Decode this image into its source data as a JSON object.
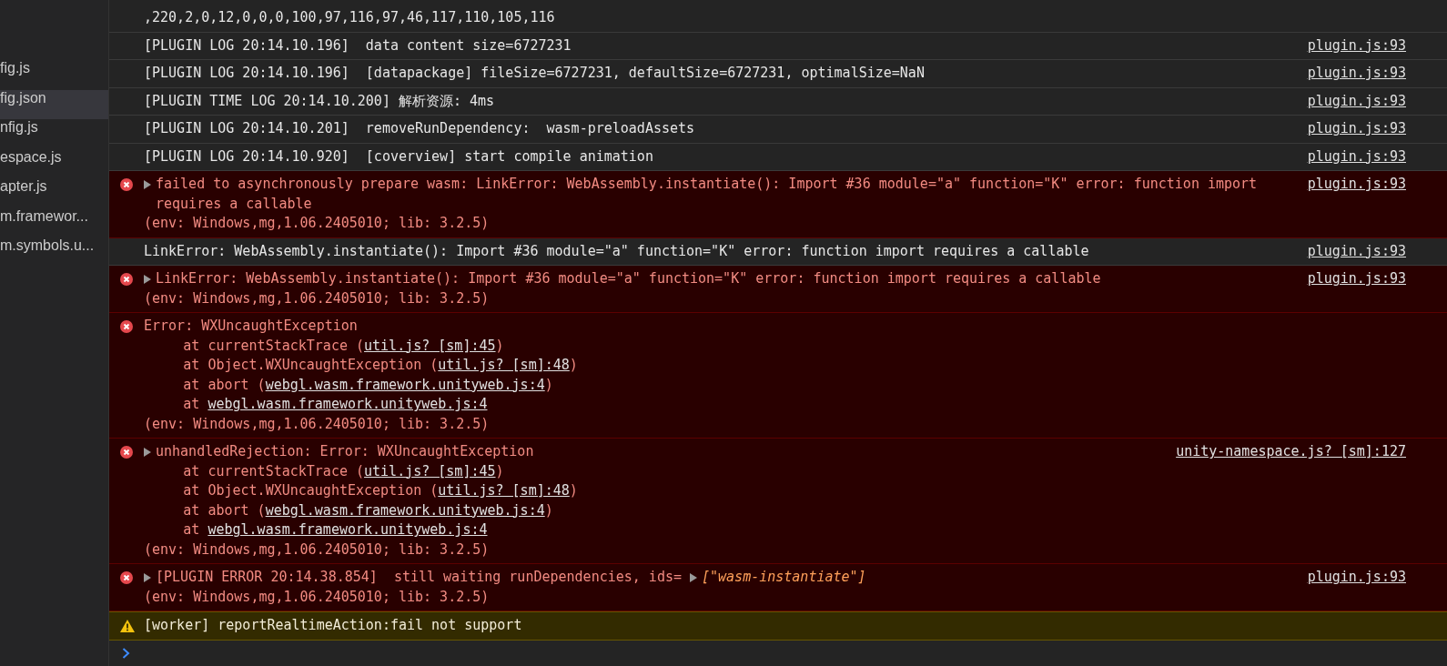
{
  "sidebar": {
    "items": [
      {
        "label": "fig.js",
        "selected": false
      },
      {
        "label": "fig.json",
        "selected": true
      },
      {
        "label": "nfig.js",
        "selected": false
      },
      {
        "label": "espace.js",
        "selected": false
      },
      {
        "label": "apter.js",
        "selected": false
      },
      {
        "label": "m.framewor...",
        "selected": false
      },
      {
        "label": "m.symbols.u...",
        "selected": false
      }
    ]
  },
  "console": {
    "rows": [
      {
        "kind": "log",
        "lines": [
          {
            "kind": "message",
            "parts": [
              {
                "kind": "text",
                "text": ",220,2,0,12,0,0,0,100,97,116,97,46,117,110,105,116"
              }
            ]
          }
        ]
      },
      {
        "kind": "log",
        "source": "plugin.js:93",
        "lines": [
          {
            "kind": "message",
            "parts": [
              {
                "kind": "text",
                "text": "[PLUGIN LOG 20:14.10.196]  data content size=6727231"
              }
            ]
          }
        ]
      },
      {
        "kind": "log",
        "source": "plugin.js:93",
        "lines": [
          {
            "kind": "message",
            "parts": [
              {
                "kind": "text",
                "text": "[PLUGIN LOG 20:14.10.196]  [datapackage] fileSize=6727231, defaultSize=6727231, optimalSize=NaN"
              }
            ]
          }
        ]
      },
      {
        "kind": "log",
        "source": "plugin.js:93",
        "lines": [
          {
            "kind": "message",
            "parts": [
              {
                "kind": "text",
                "text": "[PLUGIN TIME LOG 20:14.10.200] 解析资源: 4ms"
              }
            ]
          }
        ]
      },
      {
        "kind": "log",
        "source": "plugin.js:93",
        "lines": [
          {
            "kind": "message",
            "parts": [
              {
                "kind": "text",
                "text": "[PLUGIN LOG 20:14.10.201]  removeRunDependency:  wasm-preloadAssets"
              }
            ]
          }
        ]
      },
      {
        "kind": "log",
        "source": "plugin.js:93",
        "lines": [
          {
            "kind": "message",
            "parts": [
              {
                "kind": "text",
                "text": "[PLUGIN LOG 20:14.10.920]  [coverview] start compile animation"
              }
            ]
          }
        ]
      },
      {
        "kind": "error",
        "expandable": true,
        "source": "plugin.js:93",
        "lines": [
          {
            "kind": "message",
            "parts": [
              {
                "kind": "text",
                "text": "failed to asynchronously prepare wasm: LinkError: WebAssembly.instantiate(): Import #36 module=\"a\" function=\"K\" error: function import requires a callable"
              }
            ]
          },
          {
            "kind": "message",
            "parts": [
              {
                "kind": "text",
                "text": "(env: Windows,mg,1.06.2405010; lib: 3.2.5)"
              }
            ]
          }
        ]
      },
      {
        "kind": "log",
        "source": "plugin.js:93",
        "lines": [
          {
            "kind": "message",
            "parts": [
              {
                "kind": "text",
                "text": "LinkError: WebAssembly.instantiate(): Import #36 module=\"a\" function=\"K\" error: function import requires a callable"
              }
            ]
          }
        ]
      },
      {
        "kind": "error",
        "expandable": true,
        "source": "plugin.js:93",
        "lines": [
          {
            "kind": "message",
            "parts": [
              {
                "kind": "text",
                "text": "LinkError: WebAssembly.instantiate(): Import #36 module=\"a\" function=\"K\" error: function import requires a callable"
              }
            ]
          },
          {
            "kind": "message",
            "parts": [
              {
                "kind": "text",
                "text": "(env: Windows,mg,1.06.2405010; lib: 3.2.5)"
              }
            ]
          }
        ]
      },
      {
        "kind": "error",
        "expandable": false,
        "lines": [
          {
            "kind": "message",
            "parts": [
              {
                "kind": "text",
                "text": "Error: WXUncaughtException"
              }
            ]
          },
          {
            "kind": "frame",
            "parts": [
              {
                "kind": "text",
                "text": "at currentStackTrace ("
              },
              {
                "kind": "link",
                "text": "util.js? [sm]:45"
              },
              {
                "kind": "text",
                "text": ")"
              }
            ]
          },
          {
            "kind": "frame",
            "parts": [
              {
                "kind": "text",
                "text": "at Object.WXUncaughtException ("
              },
              {
                "kind": "link",
                "text": "util.js? [sm]:48"
              },
              {
                "kind": "text",
                "text": ")"
              }
            ]
          },
          {
            "kind": "frame",
            "parts": [
              {
                "kind": "text",
                "text": "at abort ("
              },
              {
                "kind": "link",
                "text": "webgl.wasm.framework.unityweb.js:4"
              },
              {
                "kind": "text",
                "text": ")"
              }
            ]
          },
          {
            "kind": "frame",
            "parts": [
              {
                "kind": "text",
                "text": "at "
              },
              {
                "kind": "link",
                "text": "webgl.wasm.framework.unityweb.js:4"
              }
            ]
          },
          {
            "kind": "message",
            "parts": [
              {
                "kind": "text",
                "text": "(env: Windows,mg,1.06.2405010; lib: 3.2.5)"
              }
            ]
          }
        ]
      },
      {
        "kind": "error",
        "expandable": true,
        "source": "unity-namespace.js? [sm]:127",
        "lines": [
          {
            "kind": "message",
            "parts": [
              {
                "kind": "text",
                "text": "unhandledRejection: Error: WXUncaughtException"
              }
            ]
          },
          {
            "kind": "frame",
            "parts": [
              {
                "kind": "text",
                "text": "at currentStackTrace ("
              },
              {
                "kind": "link",
                "text": "util.js? [sm]:45"
              },
              {
                "kind": "text",
                "text": ")"
              }
            ]
          },
          {
            "kind": "frame",
            "parts": [
              {
                "kind": "text",
                "text": "at Object.WXUncaughtException ("
              },
              {
                "kind": "link",
                "text": "util.js? [sm]:48"
              },
              {
                "kind": "text",
                "text": ")"
              }
            ]
          },
          {
            "kind": "frame",
            "parts": [
              {
                "kind": "text",
                "text": "at abort ("
              },
              {
                "kind": "link",
                "text": "webgl.wasm.framework.unityweb.js:4"
              },
              {
                "kind": "text",
                "text": ")"
              }
            ]
          },
          {
            "kind": "frame",
            "parts": [
              {
                "kind": "text",
                "text": "at "
              },
              {
                "kind": "link",
                "text": "webgl.wasm.framework.unityweb.js:4"
              }
            ]
          },
          {
            "kind": "message",
            "parts": [
              {
                "kind": "text",
                "text": "(env: Windows,mg,1.06.2405010; lib: 3.2.5)"
              }
            ]
          }
        ]
      },
      {
        "kind": "error",
        "expandable": true,
        "source": "plugin.js:93",
        "lines": [
          {
            "kind": "message",
            "parts": [
              {
                "kind": "text",
                "text": "[PLUGIN ERROR 20:14.38.854]  still waiting runDependencies, ids= "
              },
              {
                "kind": "array",
                "text": "[\"wasm-instantiate\"]"
              }
            ]
          },
          {
            "kind": "message",
            "parts": [
              {
                "kind": "text",
                "text": "(env: Windows,mg,1.06.2405010; lib: 3.2.5)"
              }
            ]
          }
        ]
      },
      {
        "kind": "warning",
        "lines": [
          {
            "kind": "message",
            "parts": [
              {
                "kind": "text",
                "text": "[worker] reportRealtimeAction:fail not support"
              }
            ]
          }
        ]
      }
    ]
  }
}
